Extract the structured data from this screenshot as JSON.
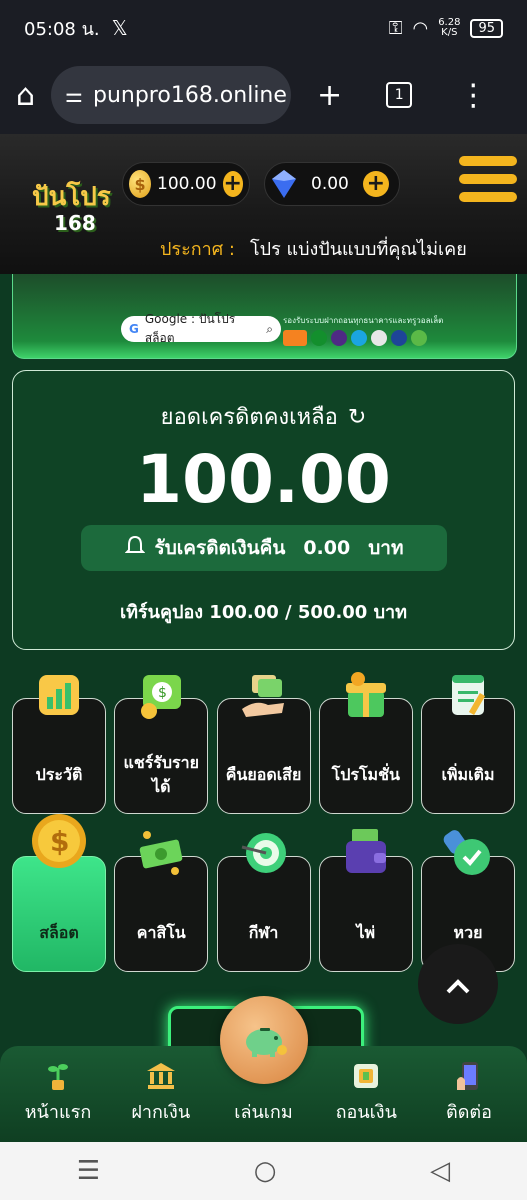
{
  "status_bar": {
    "time": "05:08 น.",
    "x_logo": "𝕏",
    "net_speed_value": "6.28",
    "net_speed_unit": "K/S",
    "battery": "95"
  },
  "browser": {
    "url": "punpro168.online",
    "tab_count": "1"
  },
  "header": {
    "logo_top": "ปันโปร",
    "logo_bottom": "168",
    "coin_balance": "100.00",
    "gem_balance": "0.00",
    "announce_label": "ประกาศ :",
    "announce_text": "โปร แบ่งปันแบบที่คุณไม่เคย"
  },
  "banner": {
    "google_search": "Google : ปันโปร สล็อต",
    "bank_caption": "รองรับระบบฝากถอนทุกธนาคารและทรูวอลเล็ต"
  },
  "credit": {
    "title": "ยอดเครดิตคงเหลือ",
    "amount": "100.00",
    "cashback_label": "รับเครดิตเงินคืน",
    "cashback_amount": "0.00",
    "cashback_unit": "บาท",
    "turnover": "เทิร์นคูปอง 100.00 / 500.00 บาท"
  },
  "menu_row1": [
    {
      "label": "ประวัติ",
      "icon": "chart-icon"
    },
    {
      "label": "แชร์รับรายได้",
      "icon": "money-share-icon"
    },
    {
      "label": "คืนยอดเสีย",
      "icon": "cashback-hand-icon"
    },
    {
      "label": "โปรโมชั่น",
      "icon": "gift-icon"
    },
    {
      "label": "เพิ่มเติม",
      "icon": "notepad-icon"
    }
  ],
  "menu_row2": [
    {
      "label": "สล็อต",
      "icon": "dollar-coin-icon"
    },
    {
      "label": "คาสิโน",
      "icon": "cash-icon"
    },
    {
      "label": "กีฬา",
      "icon": "target-icon"
    },
    {
      "label": "ไพ่",
      "icon": "wallet-icon"
    },
    {
      "label": "หวย",
      "icon": "stamp-icon"
    }
  ],
  "bottom_nav": [
    {
      "label": "หน้าแรก",
      "icon": "plant-icon"
    },
    {
      "label": "ฝากเงิน",
      "icon": "bank-icon"
    },
    {
      "label": "เล่นเกม",
      "icon": "piggy-bank-icon"
    },
    {
      "label": "ถอนเงิน",
      "icon": "atm-icon"
    },
    {
      "label": "ติดต่อ",
      "icon": "phone-icon"
    }
  ],
  "colors": {
    "accent_gold": "#f4b51e",
    "accent_green": "#3ee58a",
    "background": "#0d3a22"
  }
}
